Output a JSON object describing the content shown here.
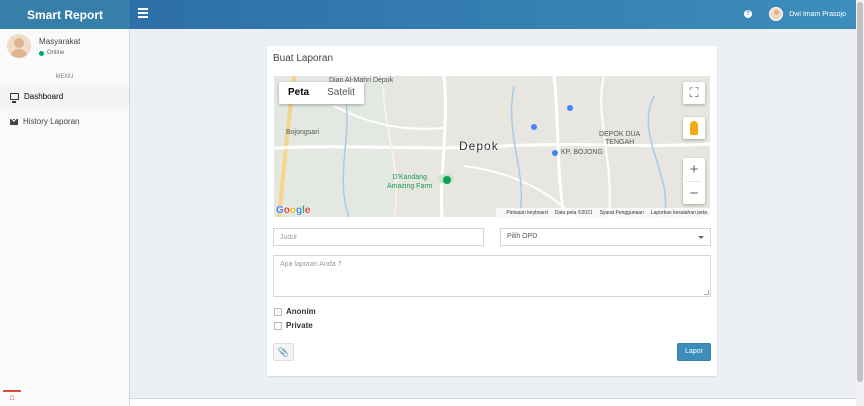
{
  "header": {
    "brand": "Smart Report",
    "menu_icon": "hamburger-icon",
    "help_icon": "question-circle-icon",
    "user_name": "Dwi Imam Prasojo"
  },
  "sidebar": {
    "user_name": "Masyarakat",
    "status": "Online",
    "menu_header": "MENU",
    "items": [
      {
        "label": "Dashboard",
        "icon": "desktop-icon",
        "active": true
      },
      {
        "label": "History Laporan",
        "icon": "envelope-icon",
        "active": false
      }
    ]
  },
  "form": {
    "title": "Buat Laporan",
    "judul_placeholder": "Judul",
    "opd_selected": "Pilih OPD",
    "isi_placeholder": "Apa laporan Anda ?",
    "anonim_label": "Anonim",
    "private_label": "Private",
    "attach_icon": "paperclip-icon",
    "submit_label": "Lapor"
  },
  "map": {
    "tab_map": "Peta",
    "tab_satellite": "Satelit",
    "zoom_in": "+",
    "zoom_out": "−",
    "city": "Depok",
    "labels": {
      "top": "Dian Al-Mahri Depok",
      "bojongsari": "Bojongsari",
      "depok_dua": "DEPOK DUA",
      "tengah": "TENGAH",
      "kp_bojong": "KP. BOJONG",
      "dkandang1": "D'Kandang",
      "dkandang2": "Amazing Farm"
    },
    "footer": {
      "keyboard": "Pintasan keyboard",
      "data": "Data peta ©2021",
      "terms": "Syarat Penggunaan",
      "report": "Laporkan kesalahan peta"
    },
    "logo": "Google"
  },
  "colors": {
    "brand": "#367fa9",
    "primary": "#3c8dbc",
    "online": "#00a65a"
  }
}
